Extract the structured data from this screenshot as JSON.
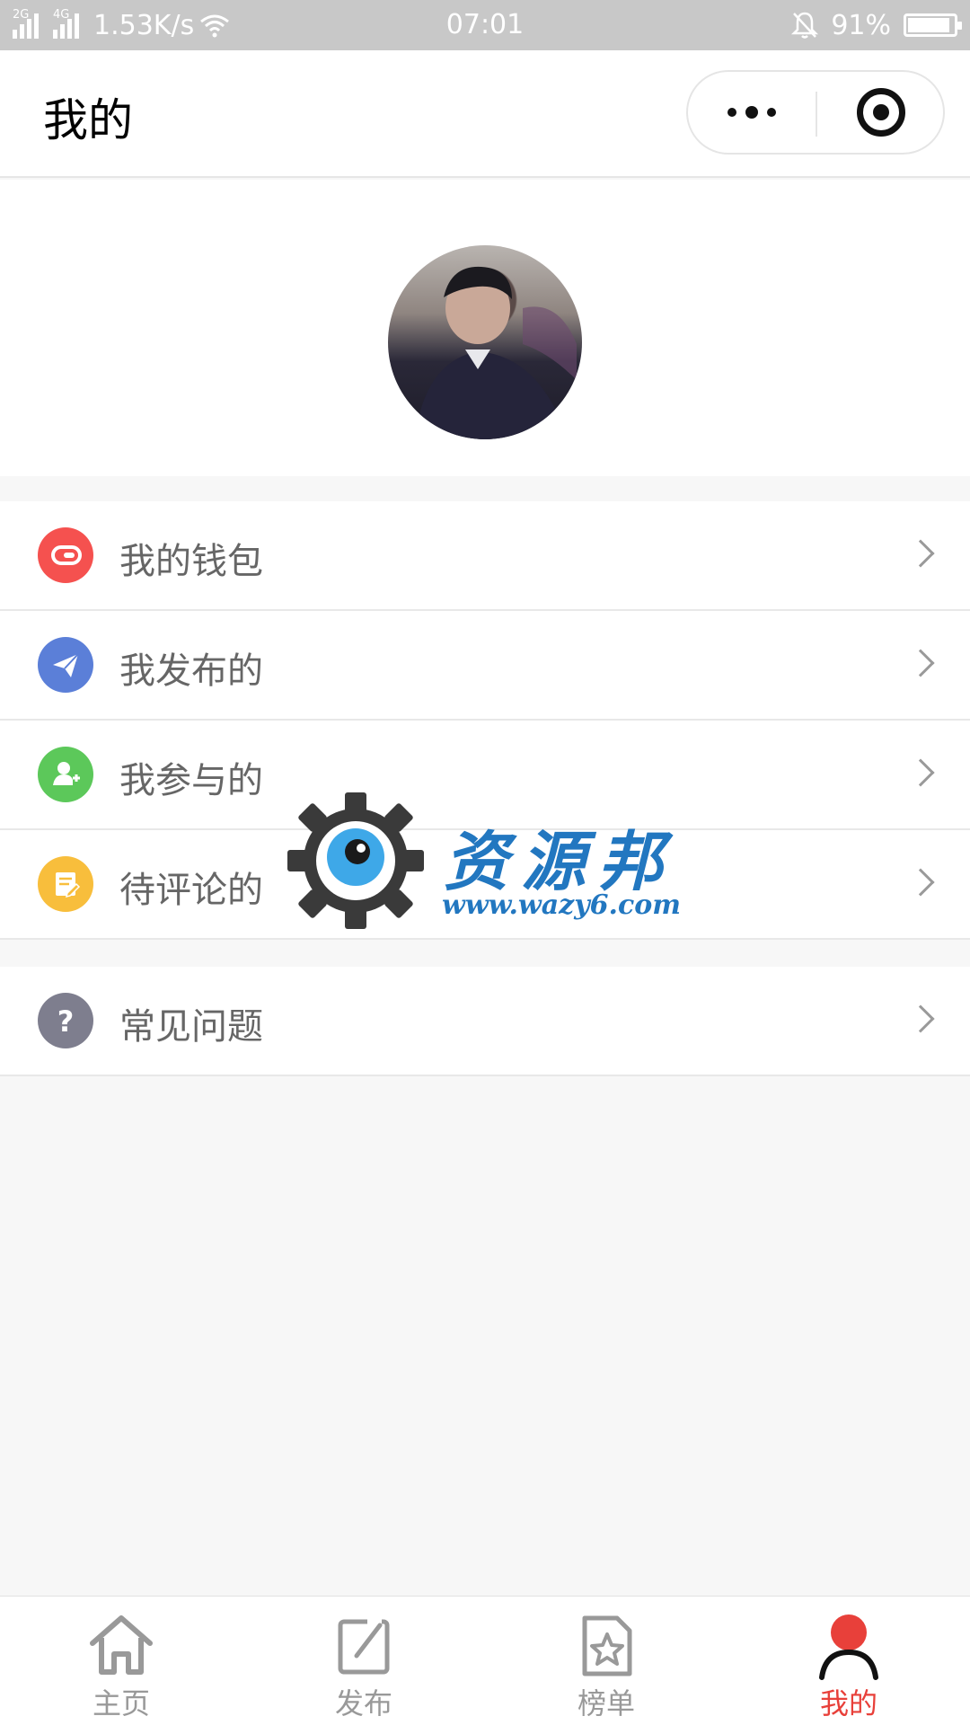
{
  "status_bar": {
    "network1": "2G",
    "network2": "4G",
    "speed": "1.53K/s",
    "time": "07:01",
    "battery": "91%",
    "battery_level": 0.91
  },
  "nav": {
    "title": "我的"
  },
  "menu_group1": [
    {
      "label": "我的钱包",
      "icon": "wallet-icon",
      "color": "#f5514f"
    },
    {
      "label": "我发布的",
      "icon": "paper-plane-icon",
      "color": "#5b7fd8"
    },
    {
      "label": "我参与的",
      "icon": "user-add-icon",
      "color": "#5cc85a"
    },
    {
      "label": "待评论的",
      "icon": "note-edit-icon",
      "color": "#f8be3c"
    }
  ],
  "menu_group2": [
    {
      "label": "常见问题",
      "icon": "question-icon",
      "color": "#7e7e8e"
    }
  ],
  "watermark": {
    "text": "资源邦",
    "url": "www.wazy6.com"
  },
  "tabs": [
    {
      "label": "主页",
      "icon": "home-icon",
      "active": false
    },
    {
      "label": "发布",
      "icon": "edit-icon",
      "active": false
    },
    {
      "label": "榜单",
      "icon": "ranking-icon",
      "active": false
    },
    {
      "label": "我的",
      "icon": "profile-icon",
      "active": true
    }
  ],
  "colors": {
    "accent": "#e8403a",
    "inactive": "#999999"
  }
}
